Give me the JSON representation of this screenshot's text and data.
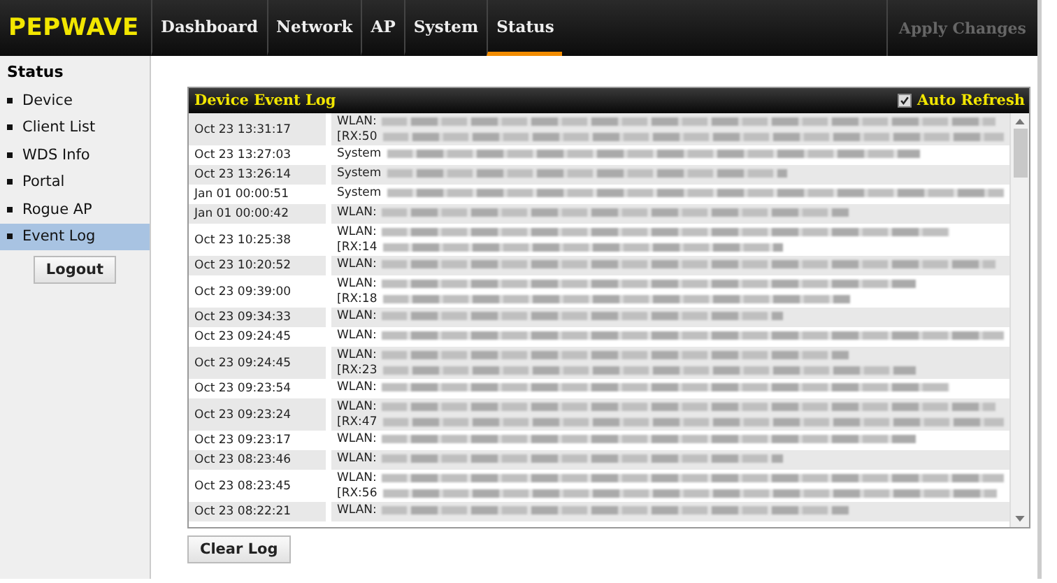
{
  "brand": "PEPWAVE",
  "nav": [
    {
      "label": "Dashboard",
      "selected": false
    },
    {
      "label": "Network",
      "selected": false
    },
    {
      "label": "AP",
      "selected": false
    },
    {
      "label": "System",
      "selected": false
    },
    {
      "label": "Status",
      "selected": true
    }
  ],
  "apply_button": {
    "label": "Apply Changes",
    "disabled": true
  },
  "sidebar": {
    "title": "Status",
    "items": [
      {
        "label": "Device",
        "selected": false
      },
      {
        "label": "Client List",
        "selected": false
      },
      {
        "label": "WDS Info",
        "selected": false
      },
      {
        "label": "Portal",
        "selected": false
      },
      {
        "label": "Rogue AP",
        "selected": false
      },
      {
        "label": "Event Log",
        "selected": true
      }
    ],
    "logout": "Logout"
  },
  "panel": {
    "title": "Device Event Log",
    "auto_refresh": {
      "label": "Auto Refresh",
      "checked": true
    }
  },
  "log": [
    {
      "time": "Oct 23 13:31:17",
      "source": "WLAN:",
      "continuation": "[RX:50"
    },
    {
      "time": "Oct 23 13:27:03",
      "source": "System"
    },
    {
      "time": "Oct 23 13:26:14",
      "source": "System"
    },
    {
      "time": "Jan 01 00:00:51",
      "source": "System"
    },
    {
      "time": "Jan 01 00:00:42",
      "source": "WLAN:"
    },
    {
      "time": "Oct 23 10:25:38",
      "source": "WLAN:",
      "continuation": "[RX:14"
    },
    {
      "time": "Oct 23 10:20:52",
      "source": "WLAN:"
    },
    {
      "time": "Oct 23 09:39:00",
      "source": "WLAN:",
      "continuation": "[RX:18"
    },
    {
      "time": "Oct 23 09:34:33",
      "source": "WLAN:"
    },
    {
      "time": "Oct 23 09:24:45",
      "source": "WLAN:"
    },
    {
      "time": "Oct 23 09:24:45",
      "source": "WLAN:",
      "continuation": "[RX:23"
    },
    {
      "time": "Oct 23 09:23:54",
      "source": "WLAN:"
    },
    {
      "time": "Oct 23 09:23:24",
      "source": "WLAN:",
      "continuation": "[RX:47"
    },
    {
      "time": "Oct 23 09:23:17",
      "source": "WLAN:"
    },
    {
      "time": "Oct 23 08:23:46",
      "source": "WLAN:"
    },
    {
      "time": "Oct 23 08:23:45",
      "source": "WLAN:",
      "continuation": "[RX:56"
    },
    {
      "time": "Oct 23 08:22:21",
      "source": "WLAN:"
    }
  ],
  "clear_button": "Clear Log"
}
